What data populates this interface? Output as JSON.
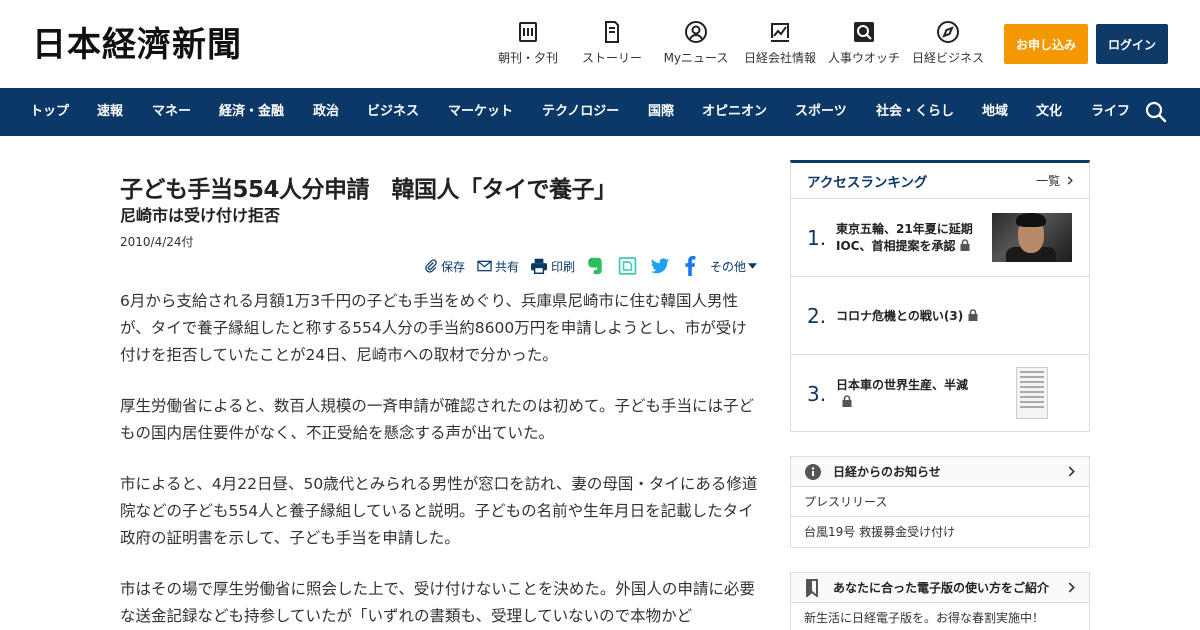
{
  "header": {
    "logo": "日本経濟新聞",
    "services": [
      {
        "label": "朝刊・夕刊",
        "icon": "newspaper-icon"
      },
      {
        "label": "ストーリー",
        "icon": "story-icon"
      },
      {
        "label": "Myニュース",
        "icon": "user-icon"
      },
      {
        "label": "日経会社情報",
        "icon": "chart-icon"
      },
      {
        "label": "人事ウオッチ",
        "icon": "search-person-icon"
      },
      {
        "label": "日経ビジネス",
        "icon": "compass-icon"
      }
    ],
    "subscribe_label": "お申し込み",
    "login_label": "ログイン",
    "colors": {
      "subscribe": "#f39800",
      "login": "#0f3a68",
      "nav": "#0b3866"
    }
  },
  "nav": {
    "items": [
      "トップ",
      "速報",
      "マネー",
      "経済・金融",
      "政治",
      "ビジネス",
      "マーケット",
      "テクノロジー",
      "国際",
      "オピニオン",
      "スポーツ",
      "社会・くらし",
      "地域",
      "文化",
      "ライフ"
    ],
    "search_icon": "search-icon"
  },
  "article": {
    "title": "子ども手当554人分申請　韓国人「タイで養子」",
    "subtitle": "尼崎市は受け付け拒否",
    "date": "2010/4/24付",
    "tools": {
      "save": "保存",
      "share": "共有",
      "print": "印刷",
      "more": "その他"
    },
    "paragraphs": [
      "6月から支給される月額1万3千円の子ども手当をめぐり、兵庫県尼崎市に住む韓国人男性が、タイで養子縁組したと称する554人分の手当約8600万円を申請しようとし、市が受け付けを拒否していたことが24日、尼崎市への取材で分かった。",
      "厚生労働省によると、数百人規模の一斉申請が確認されたのは初めて。子ども手当には子どもの国内居住要件がなく、不正受給を懸念する声が出ていた。",
      "市によると、4月22日昼、50歳代とみられる男性が窓口を訪れ、妻の母国・タイにある修道院などの子ども554人と養子縁組していると説明。子どもの名前や生年月日を記載したタイ政府の証明書を示して、子ども手当を申請した。",
      "市はその場で厚生労働省に照会した上で、受け付けないことを決めた。外国人の申請に必要な送金記録なども持参していたが「いずれの書類も、受理していないので本物かど"
    ]
  },
  "ranking": {
    "title": "アクセスランキング",
    "all_label": "一覧",
    "items": [
      {
        "num": "1.",
        "text": "東京五輪、21年夏に延期 IOC、首相提案を承認"
      },
      {
        "num": "2.",
        "text": "コロナ危機との戦い(3)"
      },
      {
        "num": "3.",
        "text": "日本車の世界生産、半減"
      }
    ]
  },
  "notice": {
    "title": "日経からのお知らせ",
    "rows": [
      "プレスリリース",
      "台風19号 救援募金受け付け"
    ]
  },
  "guide": {
    "title": "あなたに合った電子版の使い方をご紹介",
    "rows": [
      "新生活に日経電子版を。お得な春割実施中！"
    ]
  }
}
